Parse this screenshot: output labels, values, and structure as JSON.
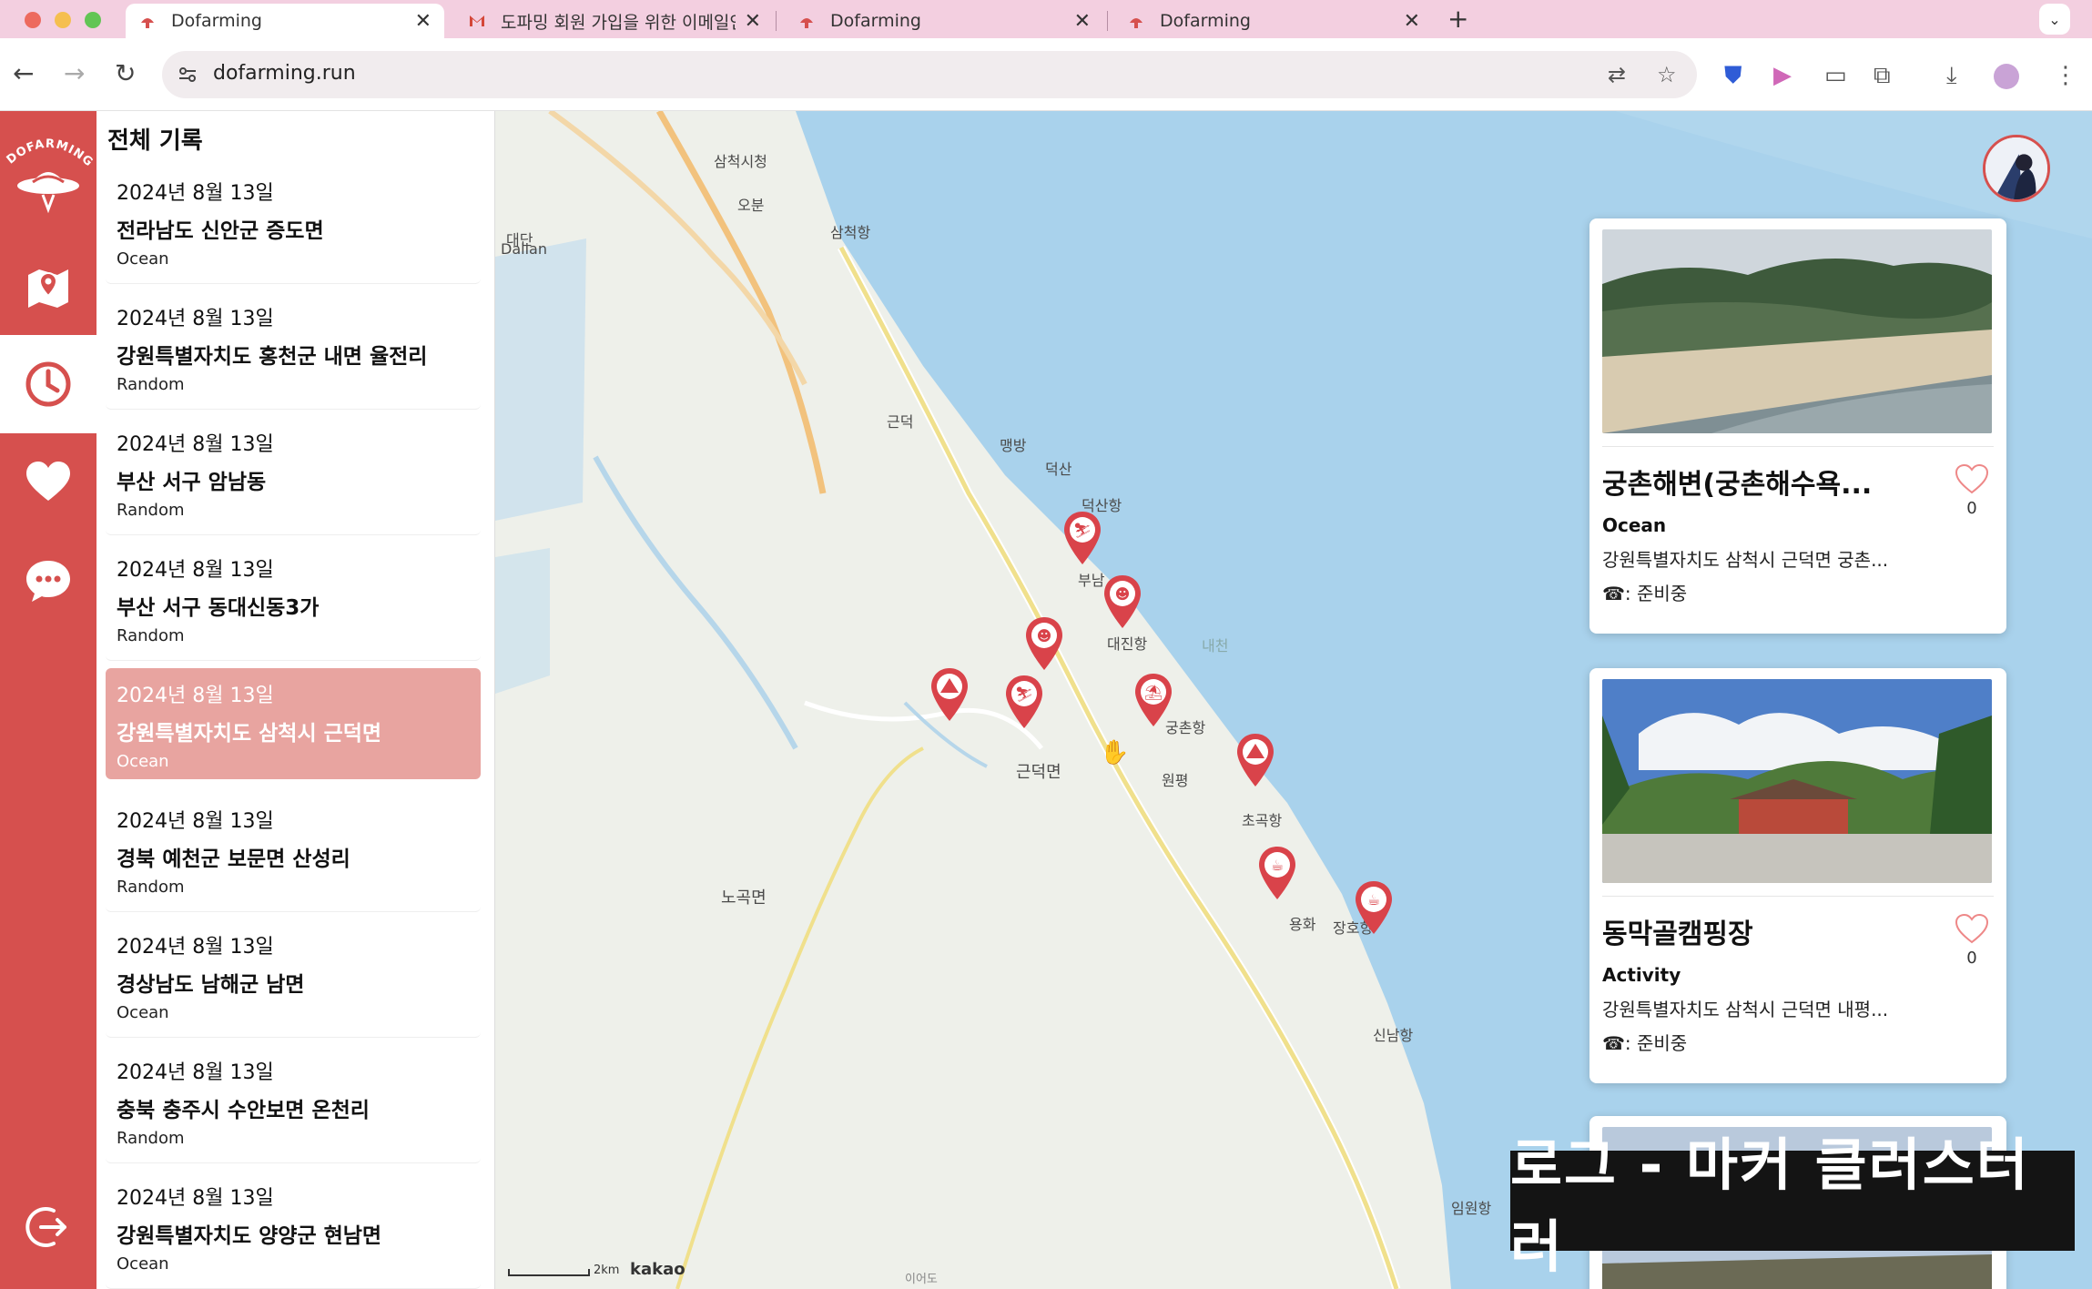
{
  "browser": {
    "tabs": [
      {
        "title": "Dofarming",
        "active": true
      },
      {
        "title": "도파밍 회원 가입을 위한 이메일인...",
        "active": false
      },
      {
        "title": "Dofarming",
        "active": false
      },
      {
        "title": "Dofarming",
        "active": false
      }
    ],
    "new_tab": "+",
    "url": "dofarming.run"
  },
  "rail": {
    "logo_text": "DOFARMING",
    "items": [
      {
        "name": "map",
        "icon": "map-pin-icon"
      },
      {
        "name": "history",
        "icon": "clock-icon",
        "active": true
      },
      {
        "name": "favorites",
        "icon": "heart-icon"
      },
      {
        "name": "chat",
        "icon": "chat-bubble-icon"
      },
      {
        "name": "logout",
        "icon": "logout-icon"
      }
    ]
  },
  "history": {
    "title": "전체 기록",
    "records": [
      {
        "date": "2024년 8월 13일",
        "location": "전라남도 신안군 증도면",
        "category": "Ocean"
      },
      {
        "date": "2024년 8월 13일",
        "location": "강원특별자치도 홍천군 내면 율전리",
        "category": "Random"
      },
      {
        "date": "2024년 8월 13일",
        "location": "부산 서구 암남동",
        "category": "Random"
      },
      {
        "date": "2024년 8월 13일",
        "location": "부산 서구 동대신동3가",
        "category": "Random"
      },
      {
        "date": "2024년 8월 13일",
        "location": "강원특별자치도 삼척시 근덕면",
        "category": "Ocean",
        "selected": true
      },
      {
        "date": "2024년 8월 13일",
        "location": "경북 예천군 보문면 산성리",
        "category": "Random"
      },
      {
        "date": "2024년 8월 13일",
        "location": "경상남도 남해군 남면",
        "category": "Ocean"
      },
      {
        "date": "2024년 8월 13일",
        "location": "충북 충주시 수안보면 온천리",
        "category": "Random"
      },
      {
        "date": "2024년 8월 13일",
        "location": "강원특별자치도 양양군 현남면",
        "category": "Ocean"
      }
    ]
  },
  "map": {
    "labels": [
      {
        "text": "삼척시청"
      },
      {
        "text": "대단"
      },
      {
        "text": "Dalian"
      },
      {
        "text": "오분"
      },
      {
        "text": "삼척항"
      },
      {
        "text": "근덕"
      },
      {
        "text": "맹방"
      },
      {
        "text": "덕산"
      },
      {
        "text": "덕산항"
      },
      {
        "text": "부남"
      },
      {
        "text": "대진항"
      },
      {
        "text": "궁촌항"
      },
      {
        "text": "원평"
      },
      {
        "text": "근덕면"
      },
      {
        "text": "초곡항"
      },
      {
        "text": "용화"
      },
      {
        "text": "장호항"
      },
      {
        "text": "신남항"
      },
      {
        "text": "노곡면"
      },
      {
        "text": "임원항"
      },
      {
        "text": "내천"
      },
      {
        "text": "이어도"
      }
    ],
    "scale": "2km",
    "attribution": "kakao",
    "markers": [
      "ski-icon",
      "swim-icon",
      "swim-icon",
      "ski-icon",
      "beach-icon",
      "tent-icon",
      "tent-icon",
      "cafe-icon",
      "cafe-icon"
    ]
  },
  "cards": [
    {
      "name": "궁촌해변(궁촌해수욕...",
      "category": "Ocean",
      "address": "강원특별자치도 삼척시 근덕면 궁촌...",
      "phone": "☎: 준비중",
      "likes": "0"
    },
    {
      "name": "동막골캠핑장",
      "category": "Activity",
      "address": "강원특별자치도 삼척시 근덕면 내평...",
      "phone": "☎: 준비중",
      "likes": "0"
    }
  ],
  "caption": "로그 - 마커 클러스터러",
  "colors": {
    "brand": "#d6504e",
    "selected_row": "#e8a4a0",
    "sea": "#a9d2ec",
    "land": "#eef0ea"
  }
}
